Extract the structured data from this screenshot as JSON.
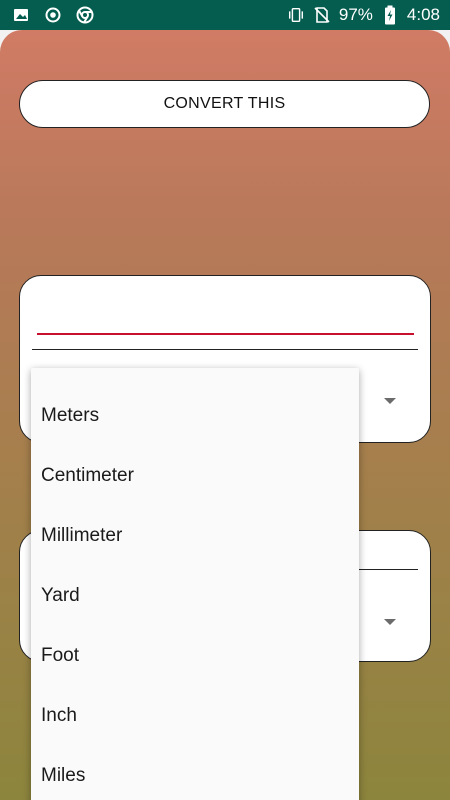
{
  "status_bar": {
    "battery": "97%",
    "time": "4:08",
    "left_icons": [
      "image-icon",
      "record-icon",
      "chrome-icon"
    ],
    "right_icons": [
      "vibrate-icon",
      "no-sim-icon",
      "battery-charging-icon"
    ]
  },
  "main": {
    "convert_label": "CONVERT THIS"
  },
  "dropdown": {
    "options": [
      "Meters",
      "Centimeter",
      "Millimeter",
      "Yard",
      "Foot",
      "Inch",
      "Miles"
    ]
  },
  "colors": {
    "status_bar": "#045d4f",
    "gradient_top": "#d17b65",
    "gradient_bottom": "#8c853d",
    "input_underline": "#c8102e"
  }
}
